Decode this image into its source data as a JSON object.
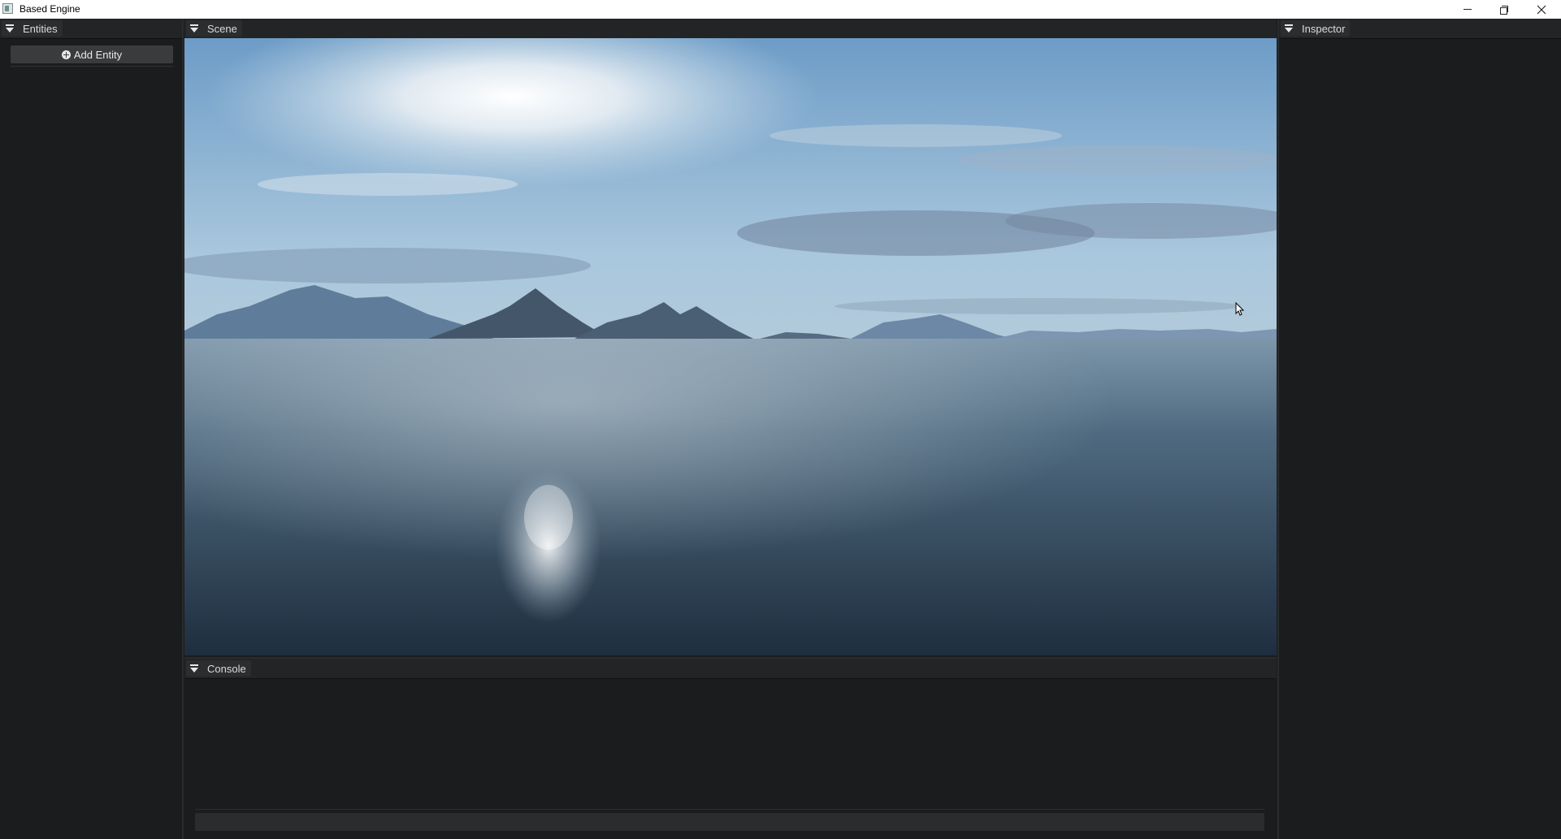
{
  "window": {
    "title": "Based Engine",
    "controls": [
      "minimize-icon",
      "maximize-icon",
      "close-icon"
    ]
  },
  "panels": {
    "entities": {
      "title": "Entities",
      "add_button_label": "Add Entity"
    },
    "scene": {
      "title": "Scene",
      "viewport_content": "ocean with mountains under cloudy sky"
    },
    "inspector": {
      "title": "Inspector"
    },
    "console": {
      "title": "Console",
      "input_value": "",
      "log_lines": []
    }
  },
  "colors": {
    "background": "#1b1c1d",
    "panel_header": "#232425",
    "tab": "#2c2d2f",
    "button": "#3a3b3d",
    "titlebar": "#ffffff"
  }
}
